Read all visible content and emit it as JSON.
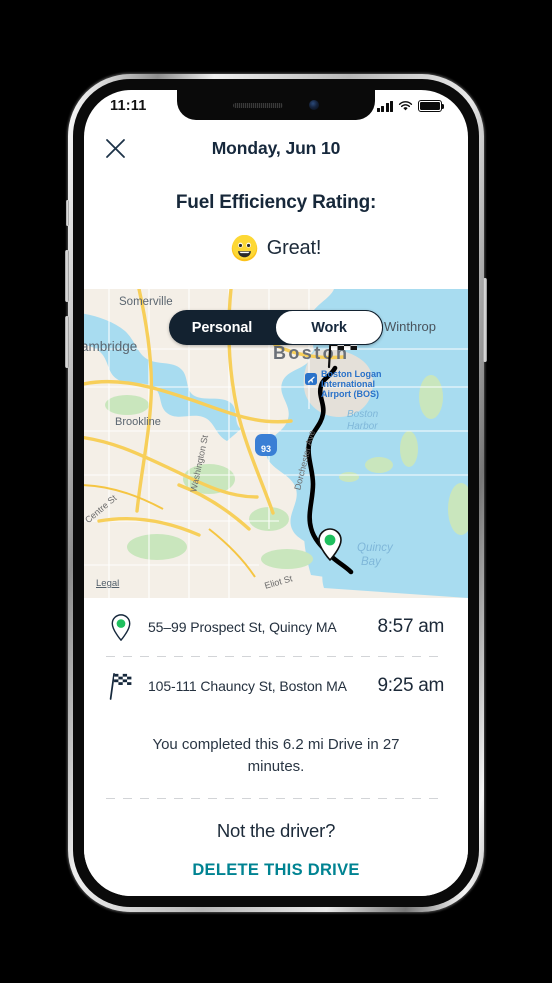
{
  "status_bar": {
    "time": "11:11",
    "signal_icon": "cellular-bars-icon",
    "wifi_icon": "wifi-icon",
    "battery_icon": "battery-full-icon"
  },
  "header": {
    "close_icon": "close-x-icon",
    "title": "Monday, Jun 10"
  },
  "rating": {
    "heading": "Fuel Efficiency Rating:",
    "emoji_icon": "grinning-face-emoji",
    "label": "Great!"
  },
  "map": {
    "toggle": {
      "options": [
        "Personal",
        "Work"
      ],
      "personal_label": "Personal",
      "work_label": "Work",
      "selected": "Personal"
    },
    "legal_label": "Legal",
    "start_pin_icon": "green-location-pin-icon",
    "end_flag_icon": "checkered-flag-icon",
    "route_color": "#000000",
    "place_labels": [
      "Somerville",
      "ambridge",
      "Boston",
      "Winthrop",
      "Brookline",
      "Boston Logan International Airport (BOS)",
      "Boston Harbor",
      "Quincy Bay",
      "Centre St",
      "Washington St",
      "Dorchester Ave",
      "Eliot St"
    ],
    "highway_shield": "93",
    "colors": {
      "water": "#a8dcf0",
      "land": "#f4efe7",
      "park": "#c9e6bd",
      "road": "#f5c542",
      "airport_label": "#3a7fd5"
    }
  },
  "trip": {
    "stops": [
      {
        "icon": "green-location-pin-icon",
        "address": "55–99 Prospect St, Quincy MA",
        "time": "8:57 am"
      },
      {
        "icon": "checkered-flag-icon",
        "address": "105-111 Chauncy St, Boston MA",
        "time": "9:25 am"
      }
    ],
    "summary": "You completed this 6.2 mi Drive in 27 minutes.",
    "not_driver_text": "Not the driver?",
    "delete_label": "DELETE THIS DRIVE",
    "delete_color": "#008392"
  }
}
